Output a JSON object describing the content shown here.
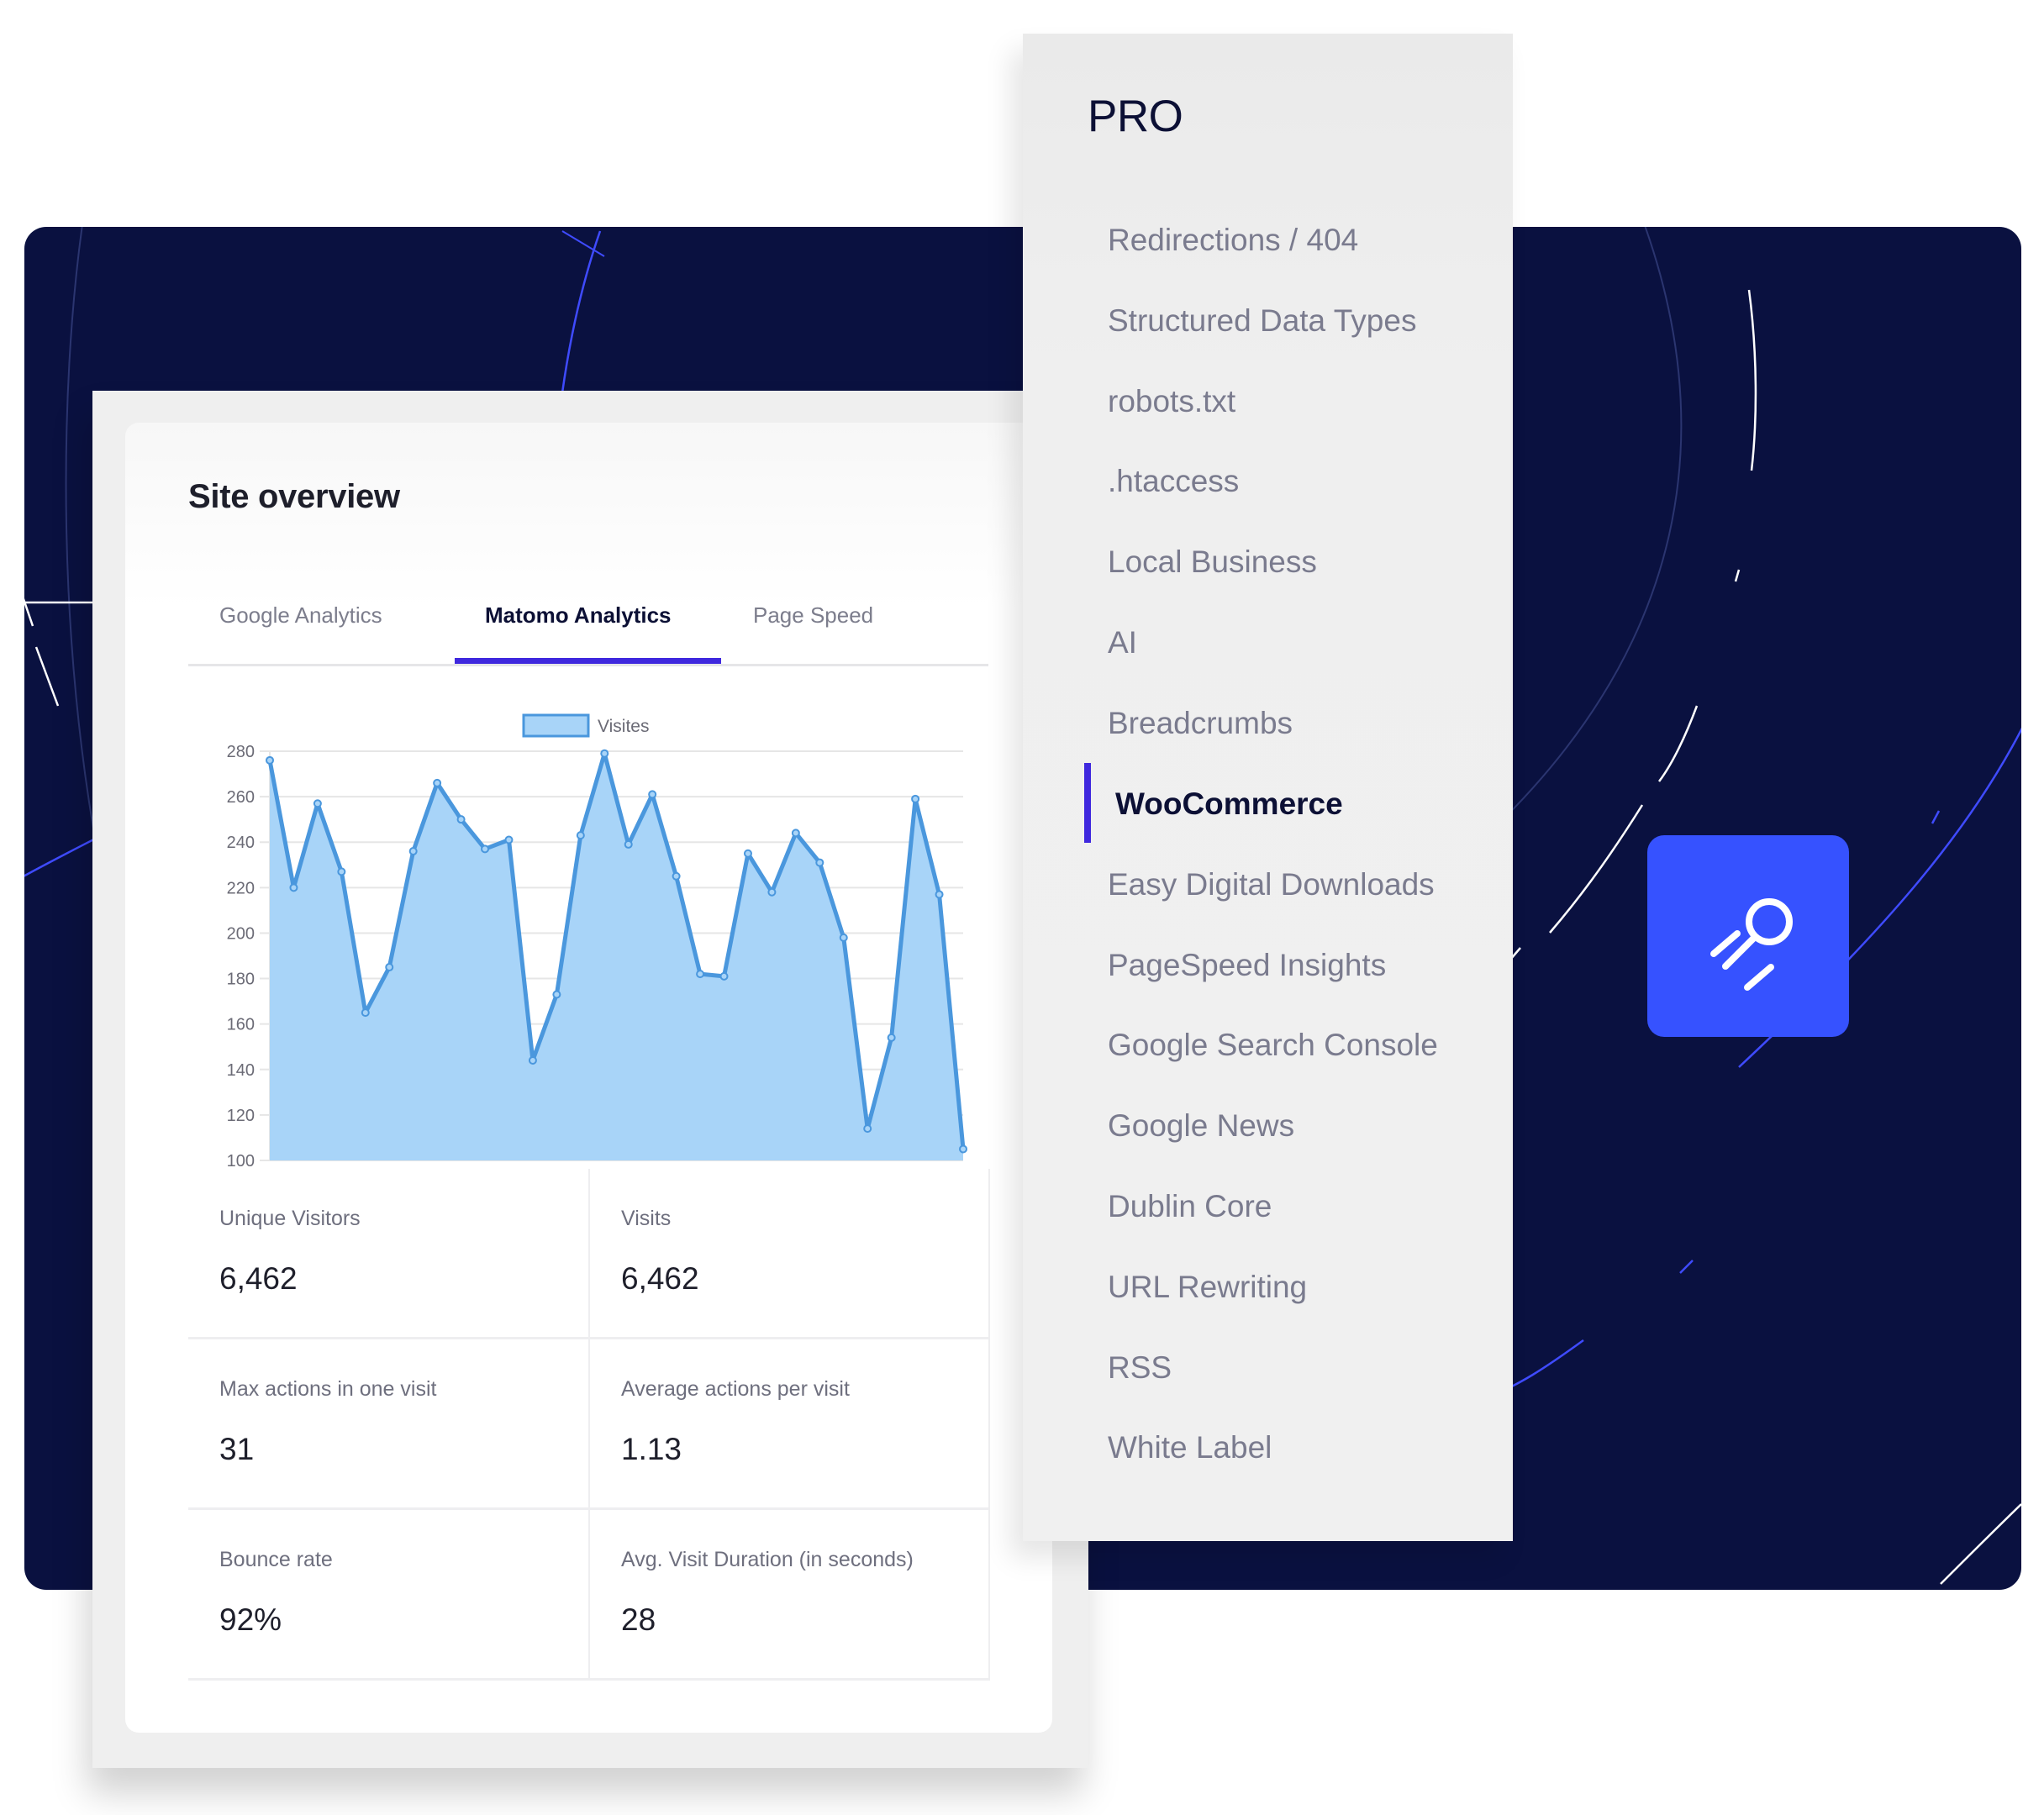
{
  "background": {
    "panel_color": "#0A1140",
    "accent_color": "#3F28DE",
    "tile_color": "#3652FF"
  },
  "overview": {
    "title": "Site overview",
    "tabs": [
      {
        "label": "Google Analytics",
        "active": false
      },
      {
        "label": "Matomo Analytics",
        "active": true
      },
      {
        "label": "Page Speed",
        "active": false
      }
    ],
    "stats": [
      {
        "label": "Unique Visitors",
        "value": "6,462"
      },
      {
        "label": "Visits",
        "value": "6,462"
      },
      {
        "label": "Max actions in one visit",
        "value": "31"
      },
      {
        "label": "Average actions per visit",
        "value": "1.13"
      },
      {
        "label": "Bounce rate",
        "value": "92%"
      },
      {
        "label": "Avg. Visit Duration (in seconds)",
        "value": "28"
      }
    ]
  },
  "chart_data": {
    "type": "area",
    "title": "",
    "xlabel": "",
    "ylabel": "",
    "legend": [
      {
        "name": "Visites",
        "position": "top-center"
      }
    ],
    "ylim": [
      100,
      280
    ],
    "yticks": [
      100,
      120,
      140,
      160,
      180,
      200,
      220,
      240,
      260,
      280
    ],
    "grid": true,
    "series": [
      {
        "name": "Visites",
        "fill_color": "#A8D4F8",
        "line_color": "#4A97DD",
        "values": [
          276,
          220,
          257,
          227,
          165,
          185,
          236,
          266,
          250,
          237,
          241,
          144,
          173,
          243,
          279,
          239,
          261,
          225,
          182,
          181,
          235,
          218,
          244,
          231,
          198,
          114,
          154,
          259,
          217,
          105
        ]
      }
    ]
  },
  "pro_menu": {
    "title": "PRO",
    "items": [
      {
        "label": "Redirections / 404",
        "active": false
      },
      {
        "label": "Structured Data Types",
        "active": false
      },
      {
        "label": "robots.txt",
        "active": false
      },
      {
        "label": ".htaccess",
        "active": false
      },
      {
        "label": "Local Business",
        "active": false
      },
      {
        "label": "AI",
        "active": false
      },
      {
        "label": "Breadcrumbs",
        "active": false
      },
      {
        "label": "WooCommerce",
        "active": true
      },
      {
        "label": "Easy Digital Downloads",
        "active": false
      },
      {
        "label": "PageSpeed Insights",
        "active": false
      },
      {
        "label": "Google Search Console",
        "active": false
      },
      {
        "label": "Google News",
        "active": false
      },
      {
        "label": "Dublin Core",
        "active": false
      },
      {
        "label": "URL Rewriting",
        "active": false
      },
      {
        "label": "RSS",
        "active": false
      },
      {
        "label": "White Label",
        "active": false
      }
    ]
  },
  "feature_icon": {
    "name": "rocket-search-icon"
  }
}
